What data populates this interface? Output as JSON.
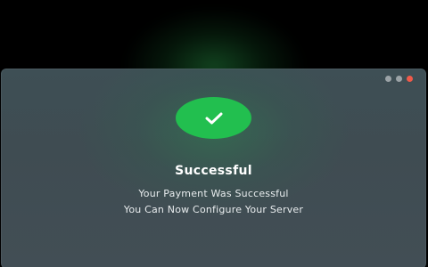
{
  "window": {
    "controls": [
      {
        "name": "minimize",
        "color": "#9ba3a7"
      },
      {
        "name": "maximize",
        "color": "#9ba3a7"
      },
      {
        "name": "close",
        "color": "#f05a4a"
      }
    ]
  },
  "status": {
    "icon": "checkmark-icon",
    "icon_color": "#22bf4f",
    "title": "Successful",
    "message_line1": "Your Payment Was Successful",
    "message_line2": "You Can Now Configure Your Server"
  }
}
